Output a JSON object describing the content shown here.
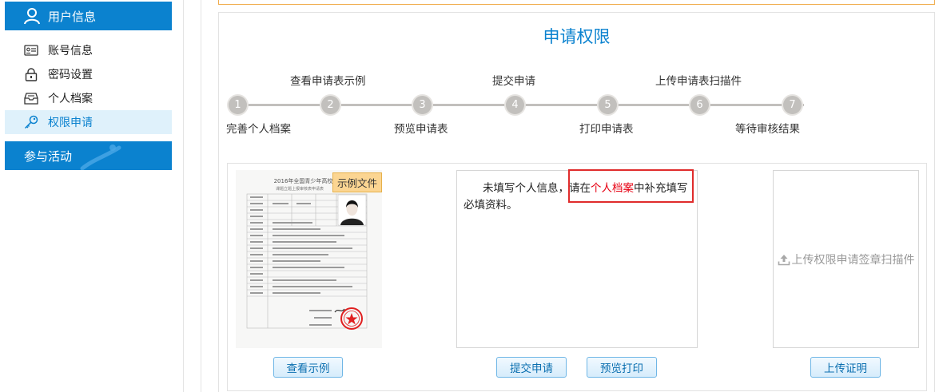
{
  "sidebar": {
    "section1_title": "用户信息",
    "section1_icon": "user-icon",
    "items": [
      {
        "label": "账号信息",
        "icon": "id-card-icon"
      },
      {
        "label": "密码设置",
        "icon": "lock-icon"
      },
      {
        "label": "个人档案",
        "icon": "archive-tray-icon"
      },
      {
        "label": "权限申请",
        "icon": "key-icon",
        "active": true
      }
    ],
    "section2_title": "参与活动"
  },
  "main": {
    "title": "申请权限",
    "steps": [
      {
        "num": "1",
        "label": "完善个人档案",
        "position": "below"
      },
      {
        "num": "2",
        "label": "查看申请表示例",
        "position": "above"
      },
      {
        "num": "3",
        "label": "预览申请表",
        "position": "below"
      },
      {
        "num": "4",
        "label": "提交申请",
        "position": "above"
      },
      {
        "num": "5",
        "label": "打印申请表",
        "position": "below"
      },
      {
        "num": "6",
        "label": "上传申请表扫描件",
        "position": "above"
      },
      {
        "num": "7",
        "label": "等待审核结果",
        "position": "below"
      }
    ],
    "sample": {
      "tag": "示例文件",
      "doc_title": "2016年全国青少年高校科",
      "doc_subtitle": "课题立题上报审核表申请表"
    },
    "info": {
      "text_before": "未填写个人信息，请在",
      "link_text": "个人档案",
      "text_after": "中补充填写必填资料。"
    },
    "upload": {
      "label": "上传权限申请签章扫描件",
      "icon": "upload-icon"
    },
    "buttons": {
      "view_sample": "查看示例",
      "submit": "提交申请",
      "preview_print": "预览打印",
      "upload_proof": "上传证明"
    }
  },
  "colors": {
    "primary": "#0b82cf",
    "highlight": "#e60012",
    "step_gray": "#c2c0bd",
    "tag_bg": "#fbd592"
  }
}
